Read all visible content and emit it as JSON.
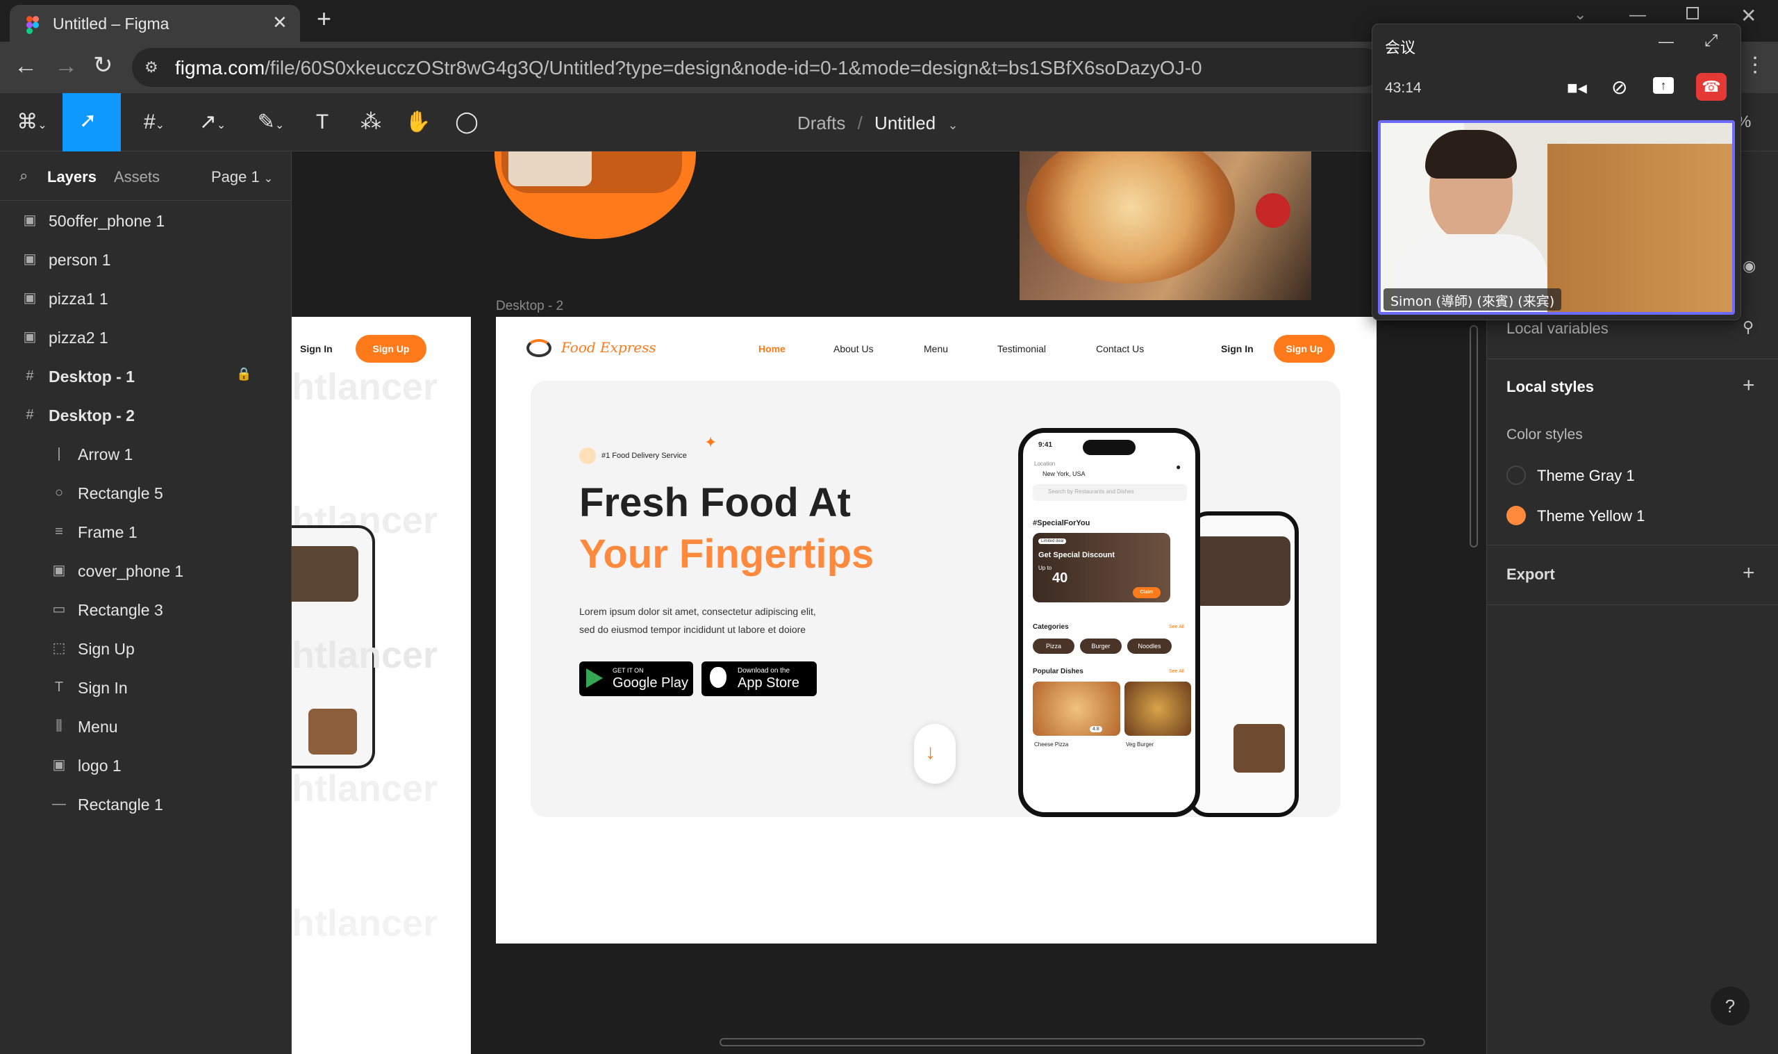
{
  "browser": {
    "tab_title": "Untitled – Figma",
    "url_domain": "figma.com",
    "url_path": "/file/60S0xkeucczOStr8wG4g3Q/Untitled?type=design&node-id=0-1&mode=design&t=bs1SBfX6soDazyOJ-0"
  },
  "toolbar": {
    "breadcrumb_parent": "Drafts",
    "breadcrumb_sep": "/",
    "file_name": "Untitled",
    "zoom": "%"
  },
  "left_panel": {
    "tab_layers": "Layers",
    "tab_assets": "Assets",
    "page": "Page 1",
    "layers": [
      {
        "label": "50offer_phone 1",
        "icon": "image-icon"
      },
      {
        "label": "person 1",
        "icon": "image-icon"
      },
      {
        "label": "pizza1 1",
        "icon": "image-icon"
      },
      {
        "label": "pizza2 1",
        "icon": "image-icon"
      },
      {
        "label": "Desktop - 1",
        "icon": "frame-icon",
        "locked": true
      },
      {
        "label": "Desktop - 2",
        "icon": "frame-icon"
      },
      {
        "label": "Arrow 1",
        "icon": "line-icon"
      },
      {
        "label": "Rectangle 5",
        "icon": "ellipse-icon"
      },
      {
        "label": "Frame 1",
        "icon": "autolayout-icon"
      },
      {
        "label": "cover_phone 1",
        "icon": "image-icon"
      },
      {
        "label": "Rectangle 3",
        "icon": "rectangle-icon"
      },
      {
        "label": "Sign Up",
        "icon": "dashed-frame-icon"
      },
      {
        "label": "Sign In",
        "icon": "text-icon"
      },
      {
        "label": "Menu",
        "icon": "columns-icon"
      },
      {
        "label": "logo 1",
        "icon": "image-icon"
      },
      {
        "label": "Rectangle 1",
        "icon": "line-icon"
      }
    ]
  },
  "canvas": {
    "frame_label": "Desktop - 2",
    "left_frame": {
      "sign_in": "Sign In",
      "sign_up": "Sign Up",
      "watermark": "htlancer"
    },
    "site": {
      "logo_text": "Food Express",
      "nav": [
        "Home",
        "About Us",
        "Menu",
        "Testimonial",
        "Contact Us"
      ],
      "sign_in": "Sign In",
      "sign_up": "Sign Up",
      "badge": "#1 Food Delivery Service",
      "headline_1": "Fresh Food At",
      "headline_2": "Your Fingertips",
      "body_1": "Lorem ipsum dolor sit amet, consectetur adipiscing elit,",
      "body_2": "sed do eiusmod tempor incididunt ut labore et doiore",
      "google_top": "GET IT ON",
      "google_main": "Google Play",
      "apple_top": "Download on the",
      "apple_main": "App Store",
      "phone": {
        "time": "9:41",
        "location_label": "Location",
        "location": "New York, USA",
        "search": "Search by Restaurants and Dishes",
        "special": "#SpecialForYou",
        "limited": "Limited deal",
        "discount": "Get Special Discount",
        "upto": "Up to",
        "pct": "40",
        "claim": "Claim",
        "categories": "Categories",
        "see_all": "See All",
        "cats": [
          "Pizza",
          "Burger",
          "Noodles"
        ],
        "popular": "Popular Dishes",
        "dishes": [
          "Cheese Pizza",
          "Veg Burger"
        ],
        "rating": "4.8"
      }
    }
  },
  "right_panel": {
    "local_variables": "Local variables",
    "local_styles": "Local styles",
    "color_styles": "Color styles",
    "styles": [
      {
        "name": "Theme Gray 1",
        "color": "#2b2b2b"
      },
      {
        "name": "Theme Yellow 1",
        "color": "#ff8a3d"
      }
    ],
    "export": "Export"
  },
  "meeting": {
    "title": "会议",
    "timer": "43:14",
    "participant": "Simon (導師) (來賓) (来宾)"
  },
  "colors": {
    "accent": "#0d99ff",
    "brand_orange": "#ff7a1a",
    "end_call": "#e53935"
  }
}
